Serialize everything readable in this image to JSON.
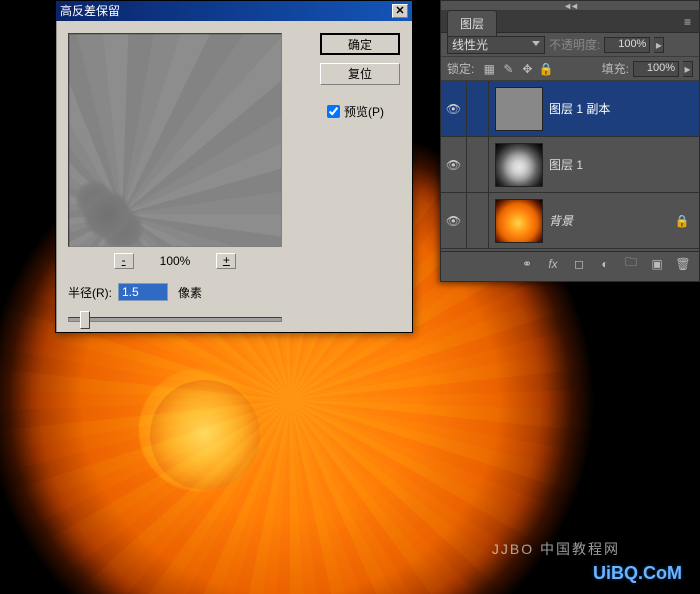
{
  "dialog": {
    "title": "高反差保留",
    "ok_label": "确定",
    "reset_label": "复位",
    "preview_checkbox_label": "预览(P)",
    "zoom_out": "-",
    "zoom_label": "100%",
    "zoom_in": "+",
    "radius_label": "半径(R):",
    "radius_value": "1.5",
    "radius_suffix": "像素"
  },
  "panel": {
    "tab_label": "图层",
    "blend_mode": "线性光",
    "opacity_label": "不透明度:",
    "opacity_value": "100%",
    "lock_label": "锁定:",
    "fill_label": "填充:",
    "fill_value": "100%",
    "layers": [
      {
        "name": "图层 1 副本",
        "visible": true,
        "active": true,
        "thumb": "gray",
        "locked": false
      },
      {
        "name": "图层 1",
        "visible": true,
        "active": false,
        "thumb": "bw",
        "locked": false
      },
      {
        "name": "背景",
        "visible": true,
        "active": false,
        "thumb": "flower",
        "locked": true
      }
    ],
    "footer_icons": [
      "link-icon",
      "fx-icon",
      "mask-icon",
      "adjust-icon",
      "group-icon",
      "new-icon",
      "trash-icon"
    ]
  },
  "watermark": {
    "main": "UiBQ.CoM",
    "sub": "JJBO 中国教程网"
  }
}
